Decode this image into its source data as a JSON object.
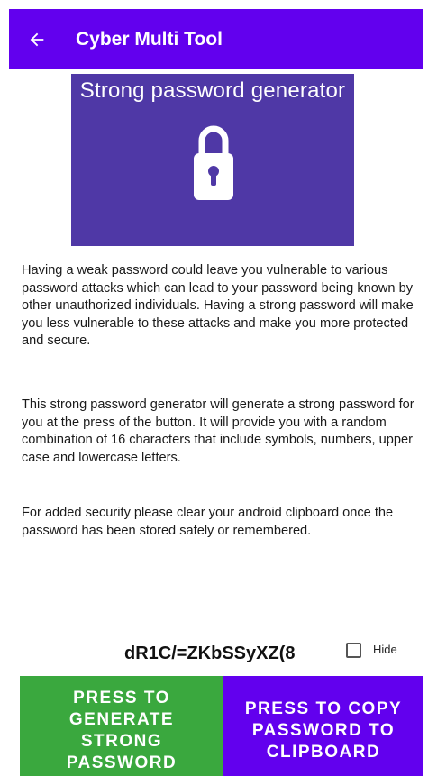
{
  "colors": {
    "appbar": "#6200ee",
    "banner": "#4f38a6",
    "generate_button": "#3aa83e",
    "copy_button": "#6200ee"
  },
  "appbar": {
    "back_icon": "arrow-left-icon",
    "title": "Cyber Multi Tool"
  },
  "banner": {
    "title": "Strong password generator",
    "icon": "lock-icon"
  },
  "description": {
    "p1": "Having a weak password could leave you vulnerable to various password attacks which can lead to your password being known by other unauthorized individuals. Having a strong password will make you less vulnerable to these attacks and make you more protected and secure.",
    "p2": "This strong password generator will generate a strong password for you at the press of the button. It will provide you with a random combination of 16 characters that include symbols, numbers, upper case and lowercase letters.",
    "p3": "For added security please clear your android clipboard once the password has been stored safely or remembered."
  },
  "password": {
    "value": "dR1C/=ZKbSSyXZ(8",
    "hide_label": "Hide",
    "hide_checked": false
  },
  "buttons": {
    "generate": "PRESS TO GENERATE STRONG PASSWORD",
    "copy": "PRESS TO COPY PASSWORD TO CLIPBOARD"
  }
}
